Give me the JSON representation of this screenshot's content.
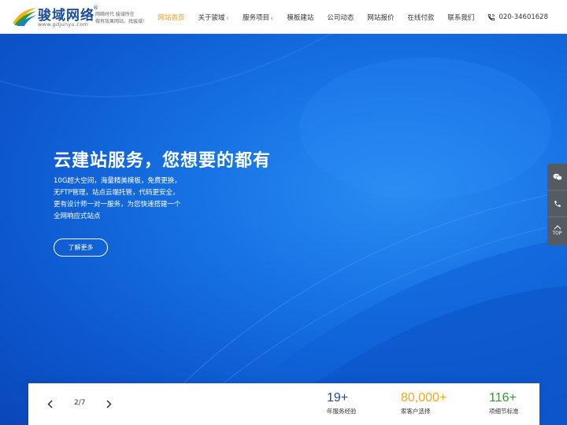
{
  "header": {
    "logo": {
      "title": "骏域网络",
      "registered": "®",
      "domain": "www.gdjunyu.com",
      "slogan_line1": "网络时代 骏域所在",
      "slogan_line2": "做有效果网站，找骏域!"
    },
    "nav": [
      {
        "label": "网站首页",
        "active": true,
        "has_dropdown": false
      },
      {
        "label": "关于骏域",
        "active": false,
        "has_dropdown": true
      },
      {
        "label": "服务项目",
        "active": false,
        "has_dropdown": true
      },
      {
        "label": "模板建站",
        "active": false,
        "has_dropdown": false
      },
      {
        "label": "公司动态",
        "active": false,
        "has_dropdown": false
      },
      {
        "label": "网站报价",
        "active": false,
        "has_dropdown": false
      },
      {
        "label": "在线付款",
        "active": false,
        "has_dropdown": false
      },
      {
        "label": "联系我们",
        "active": false,
        "has_dropdown": false
      }
    ],
    "phone": "020-34601628"
  },
  "hero": {
    "title": "云建站服务，您想要的都有",
    "desc_lines": [
      "10G超大空间，海量精美模板，免费更换，",
      "无FTP管理，站点云端托管，代码更安全，",
      "更有设计师一对一服务，为您快速搭建一个",
      "全网响应式站点"
    ],
    "button": "了解更多"
  },
  "float_bar": {
    "items": [
      "wechat-icon",
      "phone-icon",
      "back-to-top"
    ],
    "top_label": "TOP"
  },
  "slider": {
    "counter": "2/7"
  },
  "stats": [
    {
      "value": "19+",
      "label": "年服务经验",
      "color": "#1a4c9c"
    },
    {
      "value": "80,000+",
      "label": "家客户选择",
      "color": "#f0a81f"
    },
    {
      "value": "116+",
      "label": "项细节标准",
      "color": "#2f9c2c"
    }
  ],
  "colors": {
    "accent": "#f39a1e",
    "brand": "#1a4c9c",
    "hero_blue": "#1773e4"
  }
}
